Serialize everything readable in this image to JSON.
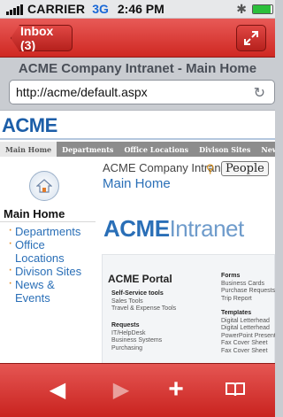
{
  "status_bar": {
    "carrier": "CARRIER",
    "network": "3G",
    "time": "2:46 PM",
    "bluetooth_icon": "bluetooth-icon",
    "battery_level": 0.9
  },
  "nav_bar": {
    "back_label": "Inbox (3)",
    "expand_icon": "expand-arrows-icon"
  },
  "page": {
    "title": "ACME Company Intranet - Main Home",
    "url": "http://acme/default.aspx",
    "reload_icon": "reload-icon"
  },
  "site": {
    "logo": "ACME",
    "tabs": [
      "Main Home",
      "Departments",
      "Office Locations",
      "Divison Sites",
      "News & Events"
    ],
    "breadcrumb": "ACME Company Intranet",
    "subtitle": "Main Home",
    "people_button": "People",
    "left_nav": {
      "heading": "Main Home",
      "items": [
        "Departments",
        "Office Locations",
        "Divison Sites",
        "News & Events"
      ]
    },
    "banner": {
      "part1": "ACME",
      "part2": "Intranet"
    },
    "portal": {
      "title": "ACME Portal",
      "selfservice_heading": "Self-Service tools",
      "selfservice_items": [
        "Sales Tools",
        "Travel & Expense Tools"
      ],
      "requests_heading": "Requests",
      "requests_items": [
        "IT/HelpDesk",
        "Business Systems",
        "Purchasing"
      ],
      "forms_heading": "Forms",
      "forms_items": [
        "Business Cards",
        "Purchase Requests",
        "Trip Report"
      ],
      "templates_heading": "Templates",
      "templates_items": [
        "Digital Letterhead",
        "Digital Letterhead",
        "PowerPoint Presentation",
        "Fax Cover Sheet",
        "Fax Cover Sheet"
      ]
    }
  },
  "toolbar": {
    "back_icon": "back-arrow-icon",
    "forward_icon": "forward-arrow-icon",
    "add_icon": "plus-icon",
    "bookmarks_icon": "bookmarks-book-icon"
  }
}
